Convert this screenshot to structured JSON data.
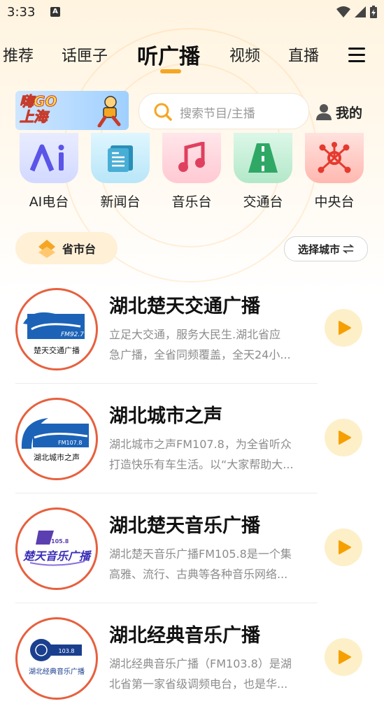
{
  "status": {
    "time": "3:33"
  },
  "tabs": [
    "推荐",
    "话匣子",
    "听广播",
    "视频",
    "直播"
  ],
  "active_tab": "听广播",
  "banner": {
    "line1": "嗨GO",
    "line2": "上海"
  },
  "search": {
    "placeholder": "搜索节目/主播"
  },
  "mine": {
    "label": "我的"
  },
  "categories": [
    {
      "label": "AI电台",
      "icon": "ai-icon",
      "color": "#dfe4ff"
    },
    {
      "label": "新闻台",
      "icon": "news-icon",
      "color": "#cfeefa"
    },
    {
      "label": "音乐台",
      "icon": "music-note-icon",
      "color": "#ffd9df"
    },
    {
      "label": "交通台",
      "icon": "road-icon",
      "color": "#cdf2dd"
    },
    {
      "label": "中央台",
      "icon": "network-icon",
      "color": "#ffd6d2"
    }
  ],
  "filters": {
    "province": "省市台",
    "city": "选择城市"
  },
  "stations": [
    {
      "title": "湖北楚天交通广播",
      "desc_line1": "立足大交通，服务大民生.湖北省应",
      "desc_line2": "急广播，全省同频覆盖，全天24小...",
      "logo_text": "楚天交通广播",
      "logo_freq": "FM92.7"
    },
    {
      "title": "湖北城市之声",
      "desc_line1": "湖北城市之声FM107.8，为全省听众",
      "desc_line2": "打造快乐有车生活。以“大家帮助大...",
      "logo_text": "湖北城市之声",
      "logo_freq": "FM107.8"
    },
    {
      "title": "湖北楚天音乐广播",
      "desc_line1": "湖北楚天音乐广播FM105.8是一个集",
      "desc_line2": "高雅、流行、古典等各种音乐网络...",
      "logo_text": "楚天音乐广播",
      "logo_freq": "105.8"
    },
    {
      "title": "湖北经典音乐广播",
      "desc_line1": "湖北经典音乐广播（FM103.8）是湖",
      "desc_line2": "北省第一家省级调频电台，也是华...",
      "logo_text": "湖北经典音乐广播",
      "logo_freq": "103.8"
    }
  ],
  "colors": {
    "accent": "#f5a623",
    "logo_ring": "#e7603e",
    "play_bg": "#fdefc8"
  }
}
